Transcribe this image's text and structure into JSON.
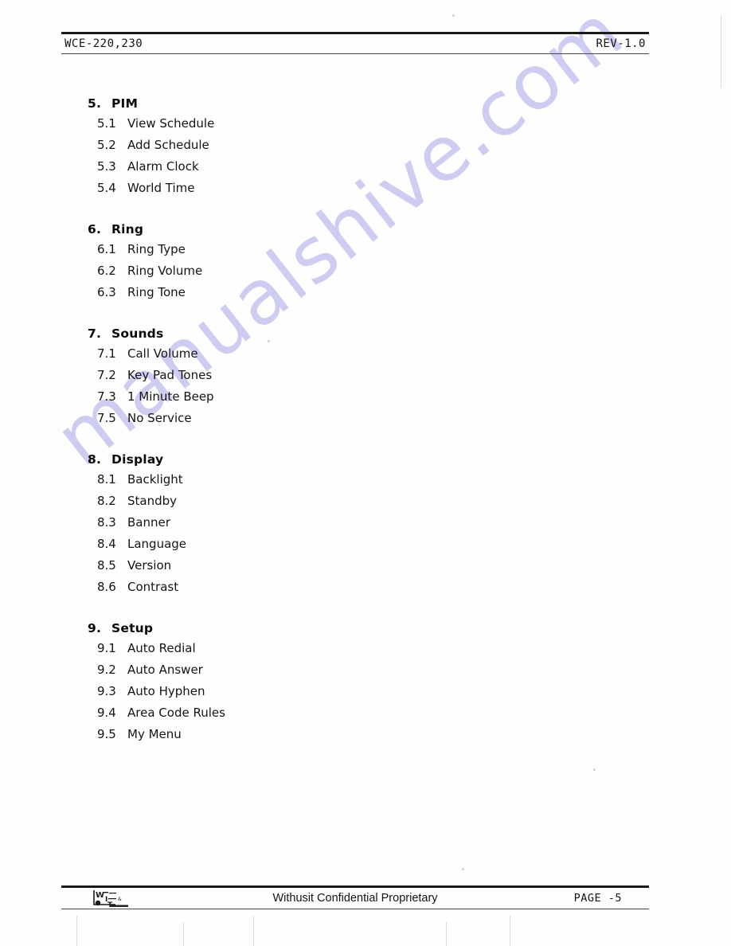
{
  "header": {
    "left_label": "WCE-220,230",
    "right_label": "REV-1.0"
  },
  "watermark": {
    "text": "manualshive.com",
    "color": "#cdcdf2"
  },
  "toc": {
    "sections": [
      {
        "number": "5.",
        "title": "PIM",
        "items": [
          {
            "number": "5.1",
            "label": "View Schedule"
          },
          {
            "number": "5.2",
            "label": "Add Schedule"
          },
          {
            "number": "5.3",
            "label": "Alarm Clock"
          },
          {
            "number": "5.4",
            "label": "World Time"
          }
        ]
      },
      {
        "number": "6.",
        "title": "Ring",
        "items": [
          {
            "number": "6.1",
            "label": "Ring Type"
          },
          {
            "number": "6.2",
            "label": "Ring Volume"
          },
          {
            "number": "6.3",
            "label": "Ring Tone"
          }
        ]
      },
      {
        "number": "7.",
        "title": "Sounds",
        "items": [
          {
            "number": "7.1",
            "label": "Call Volume"
          },
          {
            "number": "7.2",
            "label": "Key Pad Tones"
          },
          {
            "number": "7.3",
            "label": "1 Minute Beep"
          },
          {
            "number": "7.5",
            "label": "No Service"
          }
        ]
      },
      {
        "number": "8.",
        "title": "Display",
        "items": [
          {
            "number": "8.1",
            "label": "Backlight"
          },
          {
            "number": "8.2",
            "label": "Standby"
          },
          {
            "number": "8.3",
            "label": "Banner"
          },
          {
            "number": "8.4",
            "label": "Language"
          },
          {
            "number": "8.5",
            "label": "Version"
          },
          {
            "number": "8.6",
            "label": "Contrast"
          }
        ]
      },
      {
        "number": "9.",
        "title": "Setup",
        "items": [
          {
            "number": "9.1",
            "label": "Auto Redial"
          },
          {
            "number": "9.2",
            "label": "Auto Answer"
          },
          {
            "number": "9.3",
            "label": "Auto Hyphen"
          },
          {
            "number": "9.4",
            "label": "Area Code Rules"
          },
          {
            "number": "9.5",
            "label": "My Menu"
          }
        ]
      }
    ]
  },
  "footer": {
    "logo_name": "withusit-logo",
    "center_label": "Withusit Confidential Proprietary",
    "page_label": "PAGE -5"
  }
}
